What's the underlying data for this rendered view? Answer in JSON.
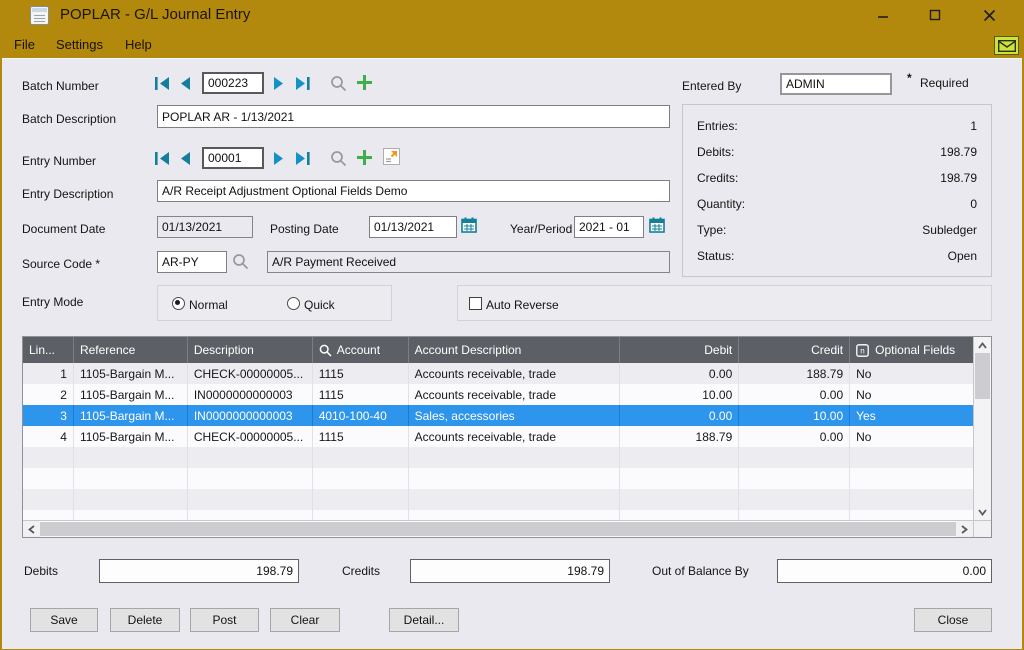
{
  "window": {
    "title": "POPLAR - G/L Journal Entry"
  },
  "menu": {
    "file": "File",
    "settings": "Settings",
    "help": "Help"
  },
  "form": {
    "batch_number": {
      "label": "Batch Number",
      "value": "000223"
    },
    "batch_description": {
      "label": "Batch Description",
      "value": "POPLAR AR - 1/13/2021"
    },
    "entered_by": {
      "label": "Entered By",
      "value": "ADMIN"
    },
    "required_marker": "*",
    "required_note": "Required",
    "entry_number": {
      "label": "Entry Number",
      "value": "00001"
    },
    "entry_description": {
      "label": "Entry Description",
      "value": "A/R Receipt Adjustment Optional Fields Demo"
    },
    "document_date": {
      "label": "Document Date",
      "value": "01/13/2021"
    },
    "posting_date": {
      "label": "Posting Date",
      "value": "01/13/2021"
    },
    "year_period": {
      "label": "Year/Period",
      "value": "2021 - 01"
    },
    "source_code": {
      "label": "Source Code *",
      "value": "AR-PY",
      "description": "A/R Payment Received"
    },
    "entry_mode": {
      "label": "Entry Mode",
      "normal": {
        "label": "Normal",
        "selected": true
      },
      "quick": {
        "label": "Quick",
        "selected": false
      }
    },
    "auto_reverse": {
      "label": "Auto Reverse",
      "checked": false
    }
  },
  "stats": {
    "entries": {
      "label": "Entries:",
      "value": "1"
    },
    "debits": {
      "label": "Debits:",
      "value": "198.79"
    },
    "credits": {
      "label": "Credits:",
      "value": "198.79"
    },
    "quantity": {
      "label": "Quantity:",
      "value": "0"
    },
    "type": {
      "label": "Type:",
      "value": "Subledger"
    },
    "status": {
      "label": "Status:",
      "value": "Open"
    }
  },
  "table": {
    "columns": {
      "line": "Lin...",
      "reference": "Reference",
      "description": "Description",
      "account": "Account",
      "account_description": "Account Description",
      "debit": "Debit",
      "credit": "Credit",
      "optional_fields": "Optional Fields"
    },
    "selected_row": 3,
    "rows": [
      {
        "line": "1",
        "reference": "1105-Bargain M...",
        "description": "CHECK-00000005...",
        "account": "1115",
        "account_description": "Accounts receivable, trade",
        "debit": "0.00",
        "credit": "188.79",
        "optional_fields": "No"
      },
      {
        "line": "2",
        "reference": "1105-Bargain M...",
        "description": "IN0000000000003",
        "account": "1115",
        "account_description": "Accounts receivable, trade",
        "debit": "10.00",
        "credit": "0.00",
        "optional_fields": "No"
      },
      {
        "line": "3",
        "reference": "1105-Bargain M...",
        "description": "IN0000000000003",
        "account": "4010-100-40",
        "account_description": "Sales, accessories",
        "debit": "0.00",
        "credit": "10.00",
        "optional_fields": "Yes"
      },
      {
        "line": "4",
        "reference": "1105-Bargain M...",
        "description": "CHECK-00000005...",
        "account": "1115",
        "account_description": "Accounts receivable, trade",
        "debit": "188.79",
        "credit": "0.00",
        "optional_fields": "No"
      }
    ]
  },
  "totals": {
    "debits": {
      "label": "Debits",
      "value": "198.79"
    },
    "credits": {
      "label": "Credits",
      "value": "198.79"
    },
    "out_of_balance": {
      "label": "Out of Balance By",
      "value": "0.00"
    }
  },
  "buttons": {
    "save": "Save",
    "delete": "Delete",
    "post": "Post",
    "clear": "Clear",
    "detail": "Detail...",
    "close": "Close"
  },
  "icons": {
    "app": "journal-notepad-icon",
    "mail": "envelope-icon",
    "nav_first": "first-record-icon",
    "nav_prev": "previous-record-icon",
    "nav_next": "next-record-icon",
    "nav_last": "last-record-icon",
    "finder": "search-icon",
    "new": "plus-icon",
    "calendar": "calendar-icon",
    "drilldown": "detail-zoom-icon",
    "optional_fields": "optional-fields-icon"
  },
  "colors": {
    "titlebar": "#B2890D",
    "accent_teal": "#12809A",
    "accent_green": "#3FAE49",
    "grid_header": "#5C6066",
    "selection": "#2E95EC",
    "mail_bg": "#CBE43C"
  }
}
